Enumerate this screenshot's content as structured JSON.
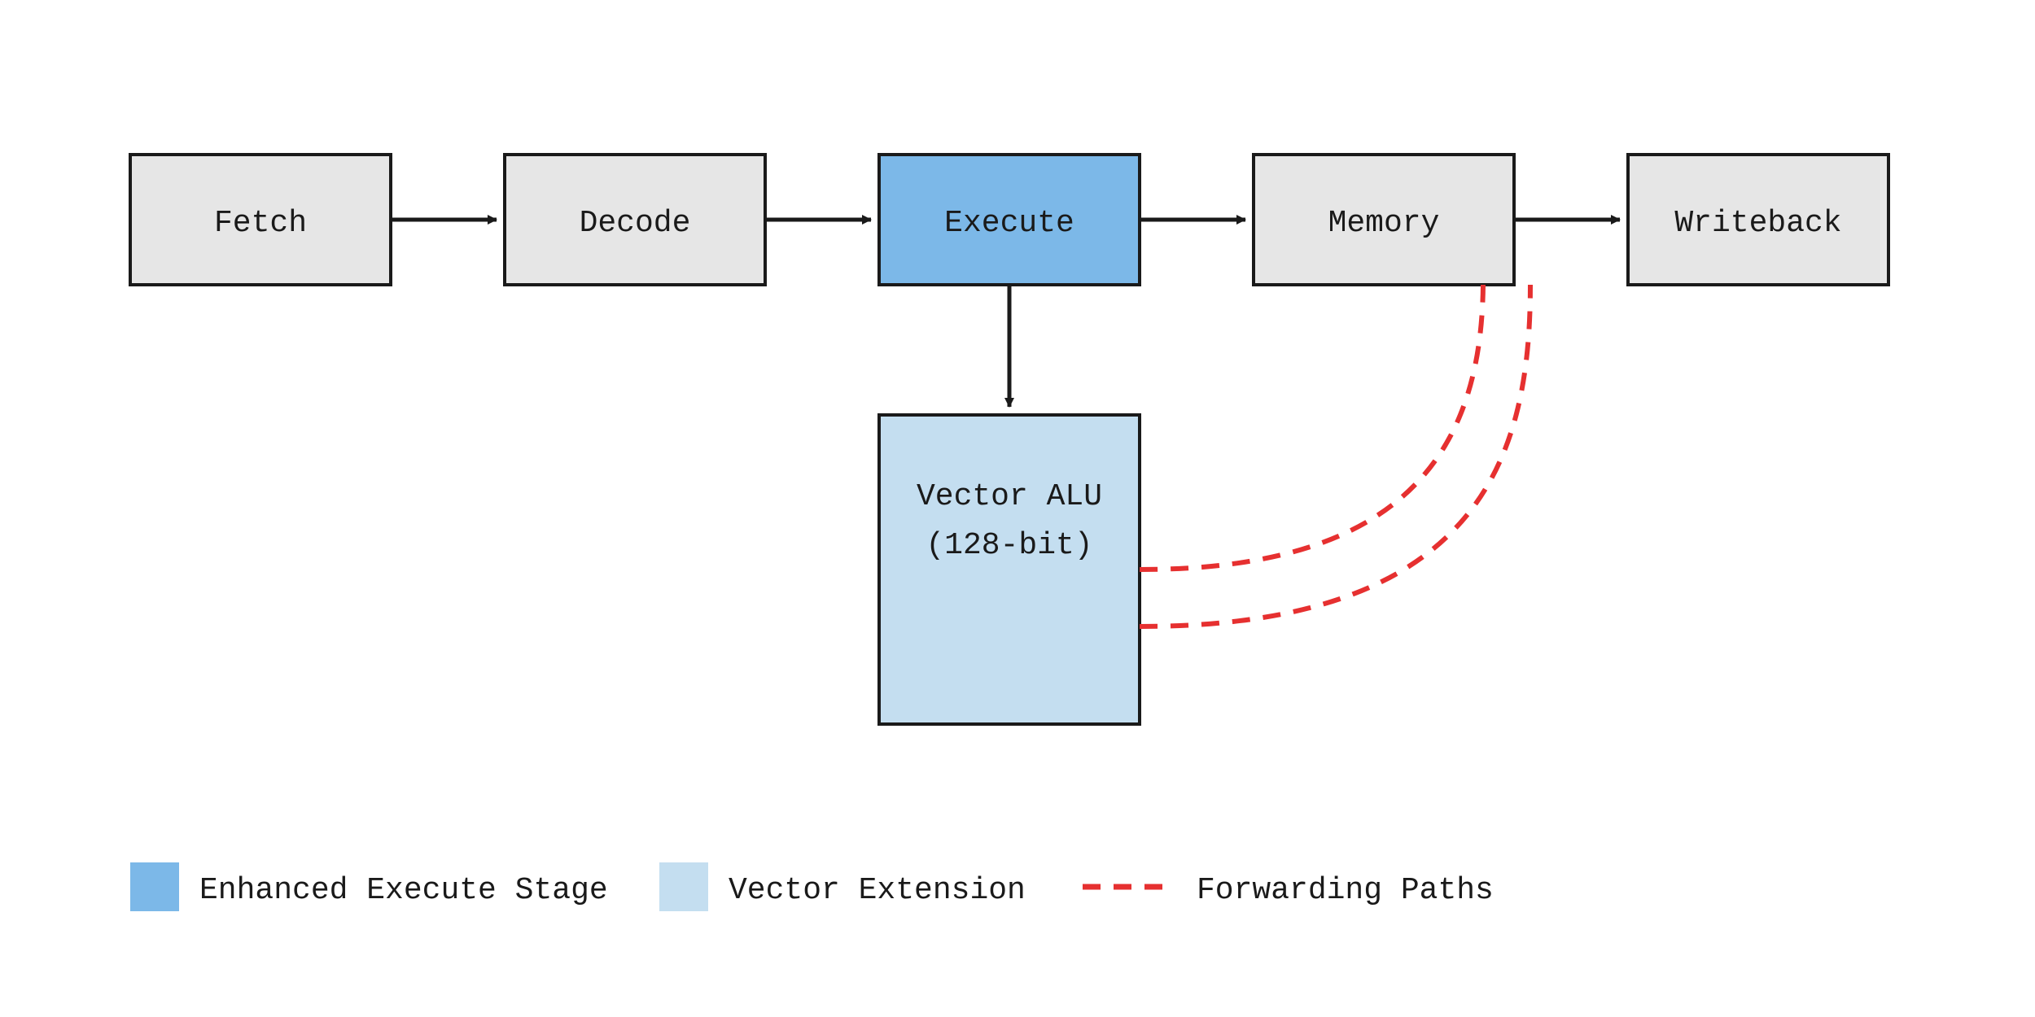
{
  "stages": {
    "fetch": {
      "label": "Fetch"
    },
    "decode": {
      "label": "Decode"
    },
    "execute": {
      "label": "Execute"
    },
    "memory": {
      "label": "Memory"
    },
    "writeback": {
      "label": "Writeback"
    }
  },
  "vector_alu": {
    "line1": "Vector ALU",
    "line2": "(128-bit)"
  },
  "legend": {
    "execute_stage": "Enhanced Execute Stage",
    "vector_ext": "Vector Extension",
    "forwarding": "Forwarding Paths"
  },
  "colors": {
    "default_fill": "#e6e6e6",
    "highlight_fill": "#7cb8e8",
    "extension_fill": "#c4def0",
    "stroke": "#1a1a1a",
    "forward": "#e63030"
  }
}
